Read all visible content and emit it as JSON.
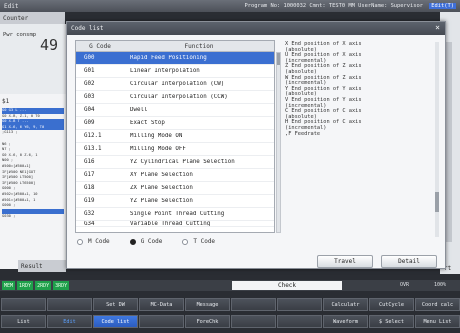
{
  "topbar": {
    "mode": "Edit",
    "program": "Program No: 1000032",
    "comment": "Cmnt: TEST0 MM",
    "user": "UserName: Supervisor",
    "badge": "Edit(T)"
  },
  "counter": {
    "title": "Counter",
    "label": "Pwr consmp",
    "value": "49"
  },
  "program_panel": {
    "header": "$1",
    "lines": [
      "G0 G3 L ...",
      "G0 X-B, Z-1, 0 T0",
      "G0 X-B T ...",
      "G1 X-6, 6 Y6, 9, T0",
      ";G113 ;",
      "",
      "N6 ;",
      "N7 ;",
      "G0 X-6, 0 Z-6, 1",
      "N00 ;",
      "#500=[#500+1]",
      "IF[#500 NE1]GOT",
      "IF[#500 LT500]",
      "IF[#500 LT6500]",
      "G000 ;",
      "#502=[#500+1, 10",
      "#501=[#500+1, 1",
      "G000 ;",
      "",
      "G030 ;"
    ]
  },
  "result_label": "Result",
  "right_tab_label": "rt",
  "dialog": {
    "title": "Code list",
    "close": "×",
    "table": {
      "col_code": "G Code",
      "col_function": "Function",
      "rows": [
        {
          "code": "G00",
          "function": "Rapid Feed Positioning"
        },
        {
          "code": "G01",
          "function": "Linear Interpolation"
        },
        {
          "code": "G02",
          "function": "Circular Interpolation (CW)"
        },
        {
          "code": "G03",
          "function": "Circular Interpolation (CCW)"
        },
        {
          "code": "G04",
          "function": "Dwell"
        },
        {
          "code": "G09",
          "function": "Exact Stop"
        },
        {
          "code": "G12.1",
          "function": "Milling Mode ON"
        },
        {
          "code": "G13.1",
          "function": "Milling Mode OFF"
        },
        {
          "code": "G16",
          "function": "YZ Cylindrical Plane Selection"
        },
        {
          "code": "G17",
          "function": "XY Plane Selection"
        },
        {
          "code": "G18",
          "function": "ZX Plane Selection"
        },
        {
          "code": "G19",
          "function": "YZ Plane Selection"
        },
        {
          "code": "G32",
          "function": "Single Point Thread Cutting"
        },
        {
          "code": "G34",
          "function": "Variable Thread Cutting"
        }
      ]
    },
    "description": [
      "X End position of X axis",
      "  (absolute)",
      "U End position of X axis",
      "  (incremental)",
      "Z End position of Z axis",
      "  (absolute)",
      "W End position of Z axis",
      "  (incremental)",
      "Y End position of Y axis",
      "  (absolute)",
      "V End position of Y axis",
      "  (incremental)",
      "C End position of C axis",
      "  (absolute)",
      "H End position of C axis",
      "  (incremental)",
      ",F Feedrate"
    ],
    "radios": {
      "m": "M Code",
      "g": "G Code",
      "t": "T Code",
      "selected": "g"
    },
    "buttons": {
      "travel": "Travel",
      "detail": "Detail"
    }
  },
  "status": {
    "chips": [
      "MEM",
      "1RDY",
      "2RDY",
      "3RDY"
    ],
    "check": "Check",
    "ovr_label": "OVR",
    "ovr_value": "100%"
  },
  "fkeys": {
    "row1": [
      "",
      "",
      "Set DW",
      "MC-Data",
      "Message",
      "",
      "",
      "Calculatr",
      "CutCycle",
      "Coord calc"
    ],
    "row2": [
      "List",
      "Edit",
      "Code list",
      "",
      "ForeChk",
      "",
      "",
      "Waveform",
      "$ Select",
      "Menu List"
    ]
  }
}
